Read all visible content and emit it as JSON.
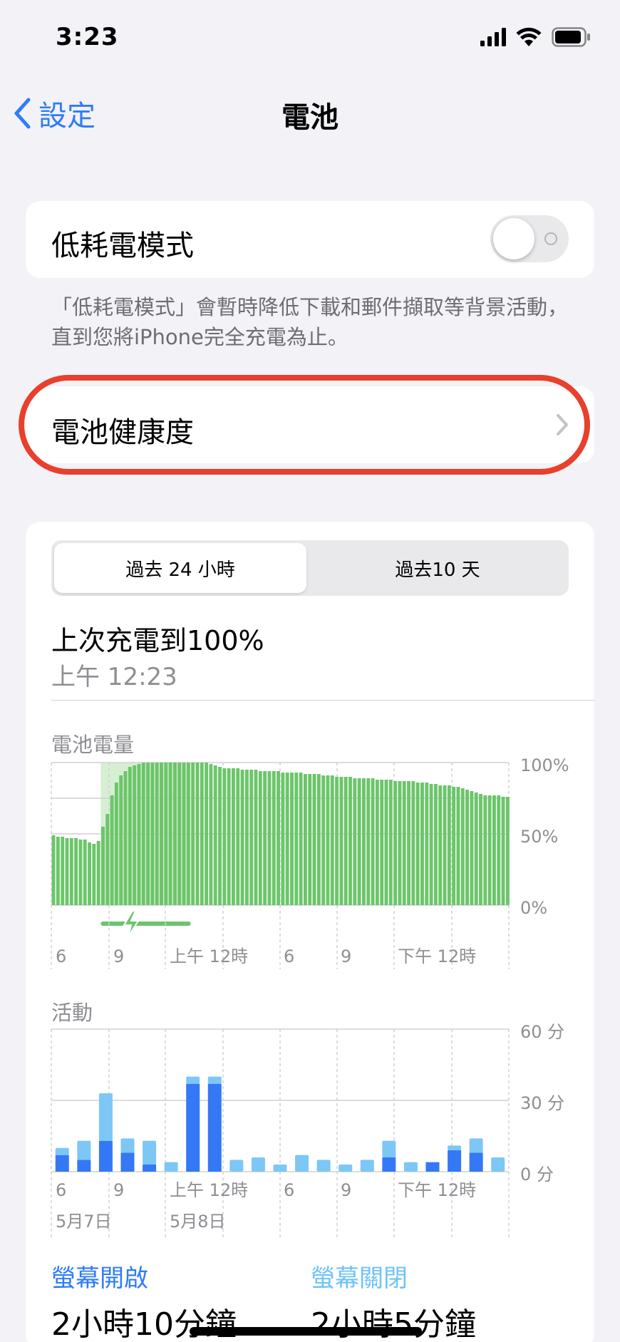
{
  "status_bar": {
    "time": "3:23"
  },
  "nav": {
    "back_label": "設定",
    "title": "電池"
  },
  "low_power": {
    "label": "低耗電模式",
    "enabled": false,
    "footnote": "「低耗電模式」會暫時降低下載和郵件擷取等背景活動，直到您將iPhone完全充電為止。"
  },
  "battery_health": {
    "label": "電池健康度"
  },
  "range_tabs": [
    {
      "label": "過去 24 小時",
      "selected": true
    },
    {
      "label": "過去10 天",
      "selected": false
    }
  ],
  "last_charge": {
    "title": "上次充電到100%",
    "time": "上午 12:23"
  },
  "colors": {
    "battery_bar": "#6cc56a",
    "charging_band": "#d6efd2",
    "screen_on": "#3478f6",
    "screen_off": "#7dc7f7",
    "highlight": "#e8402c",
    "accent": "#2f7cf6"
  },
  "chart_data": [
    {
      "type": "bar",
      "title": "電池電量",
      "y_ticks": [
        "100%",
        "50%",
        "0%"
      ],
      "x_ticks": [
        "6",
        "9",
        "上午 12時",
        "6",
        "9",
        "下午 12時"
      ],
      "ylim": [
        0,
        100
      ],
      "charging_window": [
        11,
        31
      ],
      "values": [
        49,
        48,
        48,
        47,
        47,
        47,
        46,
        46,
        44,
        43,
        45,
        55,
        64,
        77,
        86,
        91,
        94,
        97,
        98,
        99,
        100,
        100,
        100,
        100,
        100,
        100,
        100,
        100,
        100,
        100,
        100,
        100,
        100,
        100,
        100,
        99,
        98,
        97,
        96,
        96,
        96,
        96,
        95,
        95,
        95,
        95,
        94,
        94,
        94,
        94,
        94,
        93,
        93,
        93,
        93,
        93,
        92,
        92,
        92,
        92,
        91,
        91,
        91,
        90,
        90,
        90,
        90,
        89,
        89,
        89,
        89,
        89,
        88,
        88,
        88,
        88,
        87,
        87,
        87,
        87,
        87,
        86,
        86,
        86,
        85,
        85,
        84,
        84,
        84,
        83,
        83,
        82,
        81,
        80,
        79,
        78,
        77,
        77,
        77,
        77,
        76,
        76
      ]
    },
    {
      "type": "bar",
      "title": "活動",
      "y_ticks": [
        "60 分",
        "30 分",
        "0 分"
      ],
      "x_ticks": [
        "6",
        "9",
        "上午 12時",
        "6",
        "9",
        "下午 12時"
      ],
      "date_labels": [
        "5月7日",
        "5月8日"
      ],
      "ylim": [
        0,
        60
      ],
      "series": [
        {
          "name": "螢幕開啟",
          "values": [
            7,
            5,
            13,
            8,
            3,
            0,
            37,
            37,
            0,
            0,
            0,
            0,
            0,
            0,
            0,
            6,
            0,
            4,
            9,
            8,
            0
          ]
        },
        {
          "name": "螢幕關閉",
          "values": [
            3,
            8,
            20,
            6,
            10,
            4,
            3,
            3,
            5,
            6,
            3,
            7,
            5,
            3,
            5,
            7,
            4,
            0,
            2,
            6,
            6
          ]
        }
      ]
    }
  ],
  "usage": {
    "screen_on_label": "螢幕開啟",
    "screen_on_value": "2小時10分鐘",
    "screen_off_label": "螢幕關閉",
    "screen_off_value": "2小時5分鐘"
  }
}
